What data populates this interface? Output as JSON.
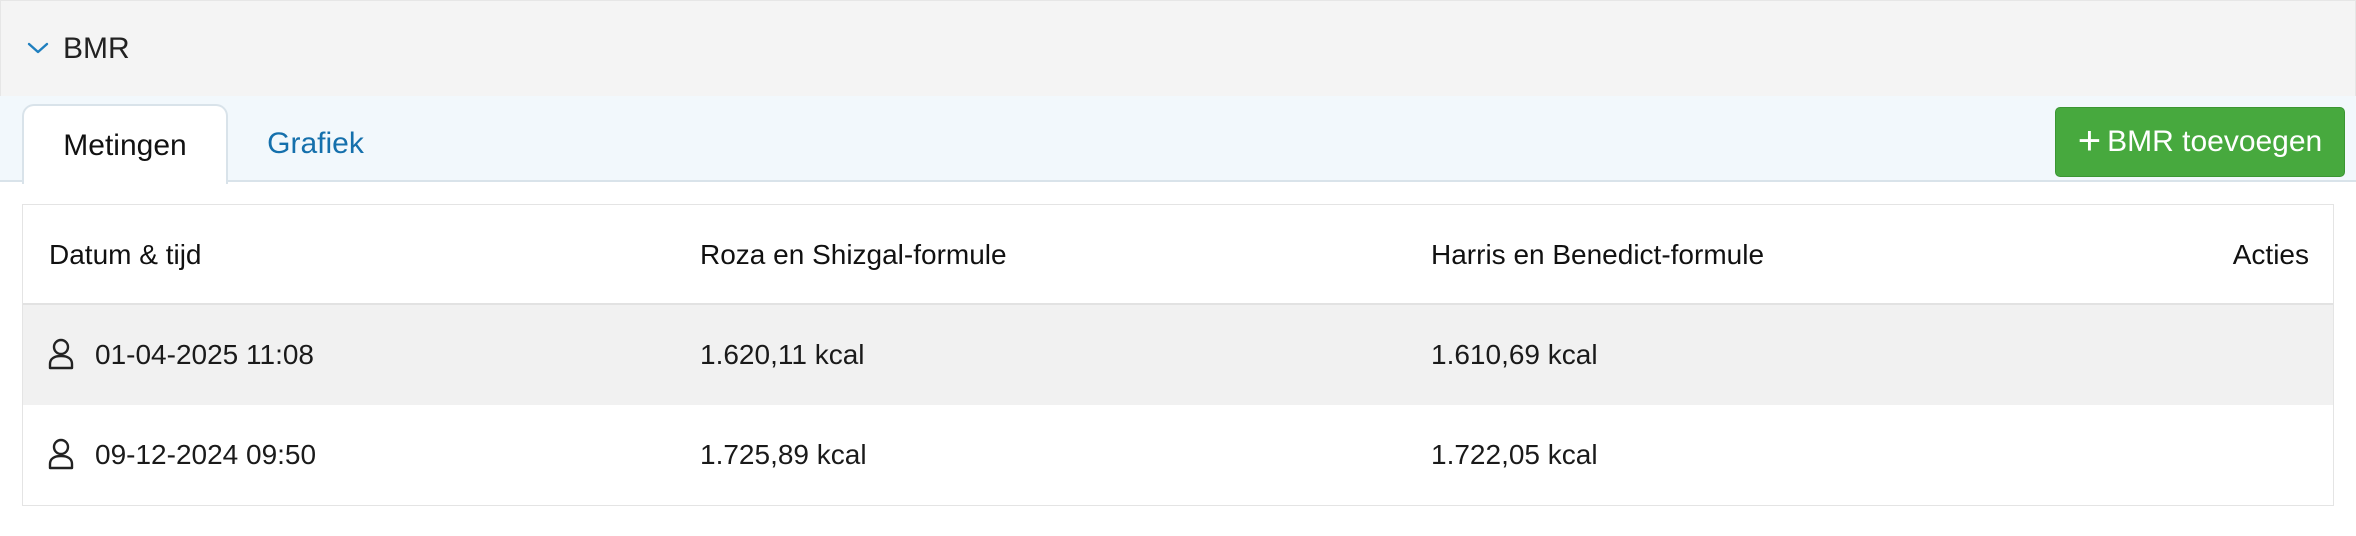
{
  "section": {
    "title": "BMR",
    "icon": "chevron-down-icon"
  },
  "tabs": [
    {
      "label": "Metingen",
      "active": true
    },
    {
      "label": "Grafiek",
      "active": false
    }
  ],
  "add_button": {
    "icon": "plus-icon",
    "label": "BMR toevoegen",
    "color": "#47a93e"
  },
  "table": {
    "columns": [
      "Datum & tijd",
      "Roza en Shizgal-formule",
      "Harris en Benedict-formule",
      "Acties"
    ],
    "rows": [
      {
        "icon": "user-icon",
        "datetime": "01-04-2025 11:08",
        "roza": "1.620,11 kcal",
        "harris": "1.610,69 kcal"
      },
      {
        "icon": "user-icon",
        "datetime": "09-12-2024 09:50",
        "roza": "1.725,89 kcal",
        "harris": "1.722,05 kcal"
      }
    ]
  },
  "colors": {
    "link": "#1570ac",
    "header_bg": "#f4f4f4",
    "tabbar_bg": "#f2f8fc",
    "striped_row": "#f1f1f1"
  }
}
